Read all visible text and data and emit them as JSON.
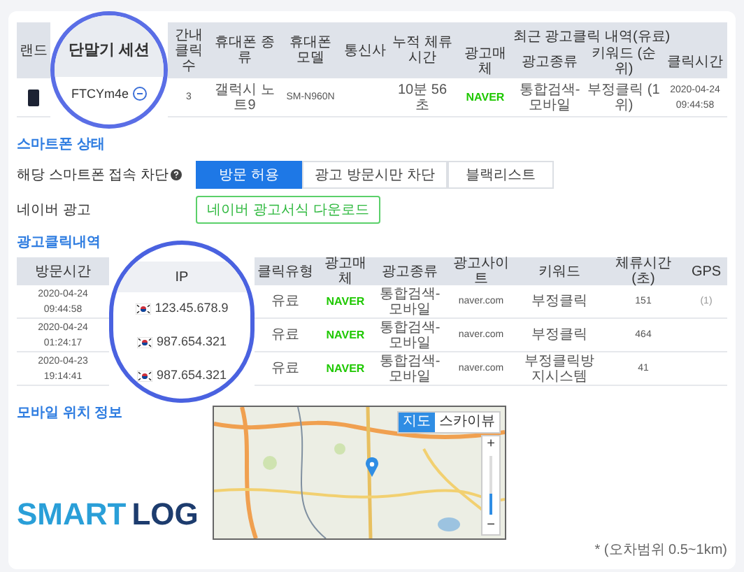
{
  "device_table": {
    "headers": [
      "랜드",
      "단말기 세션",
      "간내 클릭수",
      "휴대폰 종류",
      "휴대폰 모델",
      "통신사",
      "누적 체류시간"
    ],
    "group": {
      "title": "최근 광고클릭 내역(유료)",
      "headers": [
        "광고매체",
        "광고종류",
        "키워드 (순위)",
        "클릭시간"
      ]
    },
    "row": {
      "session": "FTCYm4e",
      "expanded": true,
      "clicks": "3",
      "phone_type": "갤럭시 노트9",
      "phone_model": "SM-N960N",
      "stay_time": "10분 56초",
      "ad_medium": "NAVER",
      "ad_type": "통합검색-모바일",
      "keyword": "부정클릭 (1위)",
      "click_time": "2020-04-24 09:44:58"
    }
  },
  "phone_status": {
    "title": "스마트폰 상태",
    "block_label": "해당 스마트폰 접속 차단",
    "block_options": [
      {
        "label": "방문 허용",
        "selected": true
      },
      {
        "label": "광고 방문시만 차단",
        "selected": false
      },
      {
        "label": "블랙리스트",
        "selected": false
      }
    ],
    "naver_label": "네이버 광고",
    "naver_button": "네이버 광고서식 다운로드"
  },
  "click_history": {
    "title": "광고클릭내역",
    "headers": [
      "방문시간",
      "IP",
      "클릭유형",
      "광고매체",
      "광고종류",
      "광고사이트",
      "키워드",
      "체류시간(초)",
      "GPS"
    ],
    "rows": [
      {
        "visit_time": "2020-04-24 09:44:58",
        "ip": "123.45.678.9",
        "click_type": "유료",
        "ad_medium": "NAVER",
        "ad_type": "통합검색-모바일",
        "site": "naver.com",
        "keyword": "부정클릭",
        "stay": "151",
        "gps": "(1)"
      },
      {
        "visit_time": "2020-04-24 01:24:17",
        "ip": "987.654.321",
        "click_type": "유료",
        "ad_medium": "NAVER",
        "ad_type": "통합검색-모바일",
        "site": "naver.com",
        "keyword": "부정클릭",
        "stay": "464"
      },
      {
        "visit_time": "2020-04-23 19:14:41",
        "ip": "987.654.321",
        "click_type": "유료",
        "ad_medium": "NAVER",
        "ad_type": "통합검색-모바일",
        "site": "naver.com",
        "keyword": "부정클릭방지시스템",
        "stay": "41"
      }
    ]
  },
  "location": {
    "title": "모바일 위치 정보",
    "map_types": [
      {
        "label": "지도",
        "selected": true
      },
      {
        "label": "스카이뷰",
        "selected": false
      }
    ],
    "zoom": {
      "in": "+",
      "out": "−",
      "level": 0.35
    },
    "note": "* (오차범위 0.5~1km)"
  },
  "logo": {
    "part_1": "SMART",
    "part_2": "LOG"
  }
}
